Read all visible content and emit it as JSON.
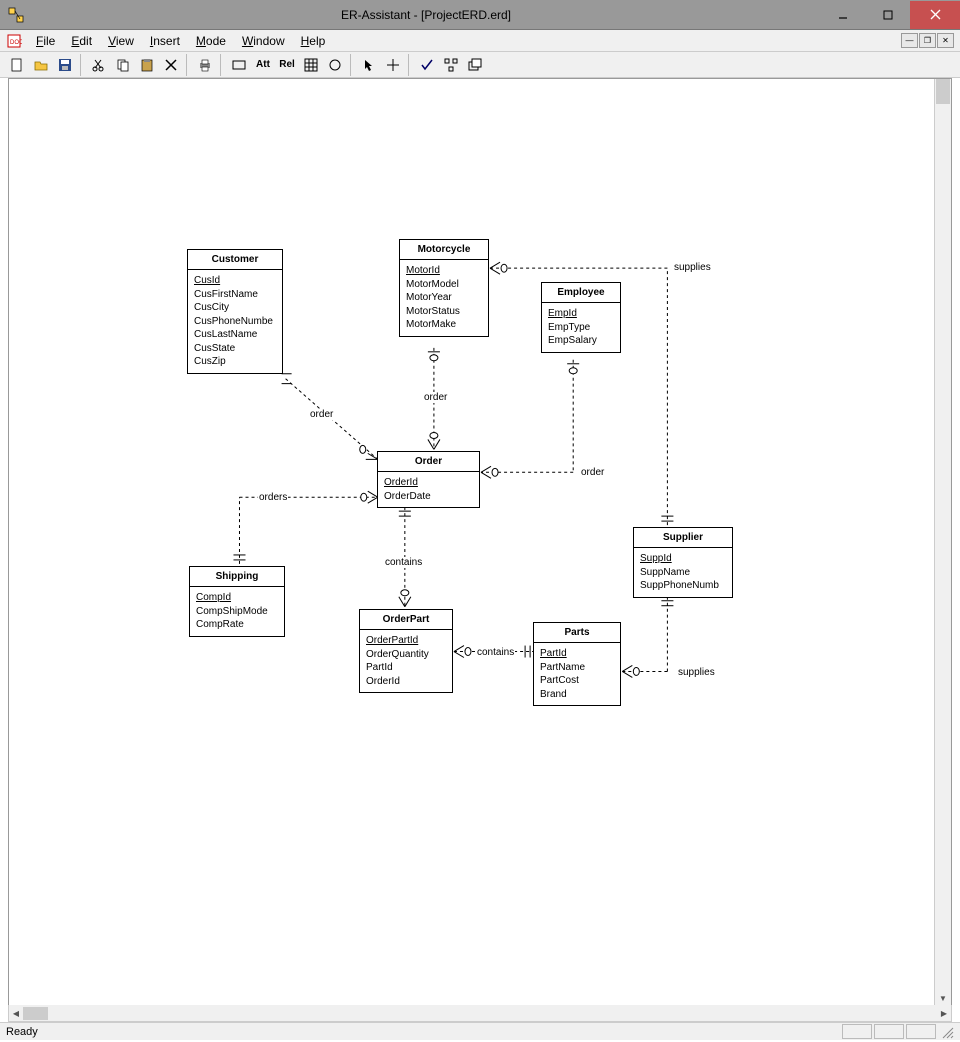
{
  "window": {
    "title": "ER-Assistant - [ProjectERD.erd]"
  },
  "statusbar": {
    "text": "Ready"
  },
  "menu": {
    "file": "File",
    "edit": "Edit",
    "view": "View",
    "insert": "Insert",
    "mode": "Mode",
    "window": "Window",
    "help": "Help"
  },
  "toolbar": {
    "att": "Att",
    "rel": "Rel"
  },
  "entities": {
    "customer": {
      "name": "Customer",
      "pk": "CusId",
      "attrs": [
        "CusFirstName",
        "CusCity",
        "CusPhoneNumbe",
        "CusLastName",
        "CusState",
        "CusZip"
      ]
    },
    "motorcycle": {
      "name": "Motorcycle",
      "pk": "MotorId",
      "attrs": [
        "MotorModel",
        "MotorYear",
        "MotorStatus",
        "MotorMake"
      ]
    },
    "employee": {
      "name": "Employee",
      "pk": "EmpId",
      "attrs": [
        "EmpType",
        "EmpSalary"
      ]
    },
    "order": {
      "name": "Order",
      "pk": "OrderId",
      "attrs": [
        "OrderDate"
      ]
    },
    "shipping": {
      "name": "Shipping",
      "pk": "CompId",
      "attrs": [
        "CompShipMode",
        "CompRate"
      ]
    },
    "orderpart": {
      "name": "OrderPart",
      "pk": "OrderPartId",
      "attrs": [
        "OrderQuantity",
        "PartId",
        "OrderId"
      ]
    },
    "parts": {
      "name": "Parts",
      "pk": "PartId",
      "attrs": [
        "PartName",
        "PartCost",
        "Brand"
      ]
    },
    "supplier": {
      "name": "Supplier",
      "pk": "SuppId",
      "attrs": [
        "SuppName",
        "SuppPhoneNumb"
      ]
    }
  },
  "relationships": {
    "cust_order": "order",
    "motor_order": "order",
    "emp_order": "order",
    "ship_order": "orders",
    "order_orderpart": "contains",
    "orderpart_parts": "contains",
    "supplier_motor": "supplies",
    "supplier_parts": "supplies"
  }
}
